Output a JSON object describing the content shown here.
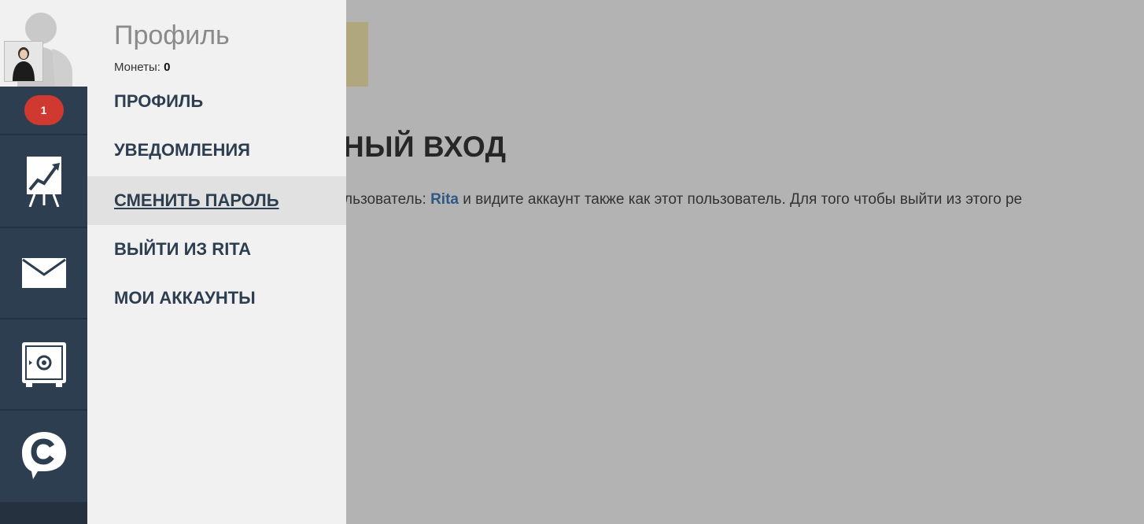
{
  "background": {
    "heading": "НЫЙ ВХОД",
    "text_before": "льзователь: ",
    "username": "Rita",
    "text_after": " и видите аккаунт также как этот пользователь. Для того чтобы выйти из этого ре"
  },
  "rail": {
    "notification_count": "1",
    "items": [
      "notifications",
      "stats-board-icon",
      "mail-icon",
      "safe-icon",
      "chat-c-icon"
    ]
  },
  "profile_panel": {
    "title": "Профиль",
    "coins_label": "Монеты:",
    "coins_value": "0",
    "menu": [
      {
        "label": "ПРОФИЛЬ"
      },
      {
        "label": "УВЕДОМЛЕНИЯ"
      },
      {
        "label": "СМЕНИТЬ ПАРОЛЬ",
        "active": true
      },
      {
        "label": "ВЫЙТИ ИЗ RITA"
      },
      {
        "label": "МОИ АККАУНТЫ"
      }
    ]
  },
  "colors": {
    "rail": "#2d3e50",
    "panel": "#f1f1f1",
    "badge": "#d0392f",
    "overlay": "#b3b3b3",
    "link": "#2d5784"
  }
}
